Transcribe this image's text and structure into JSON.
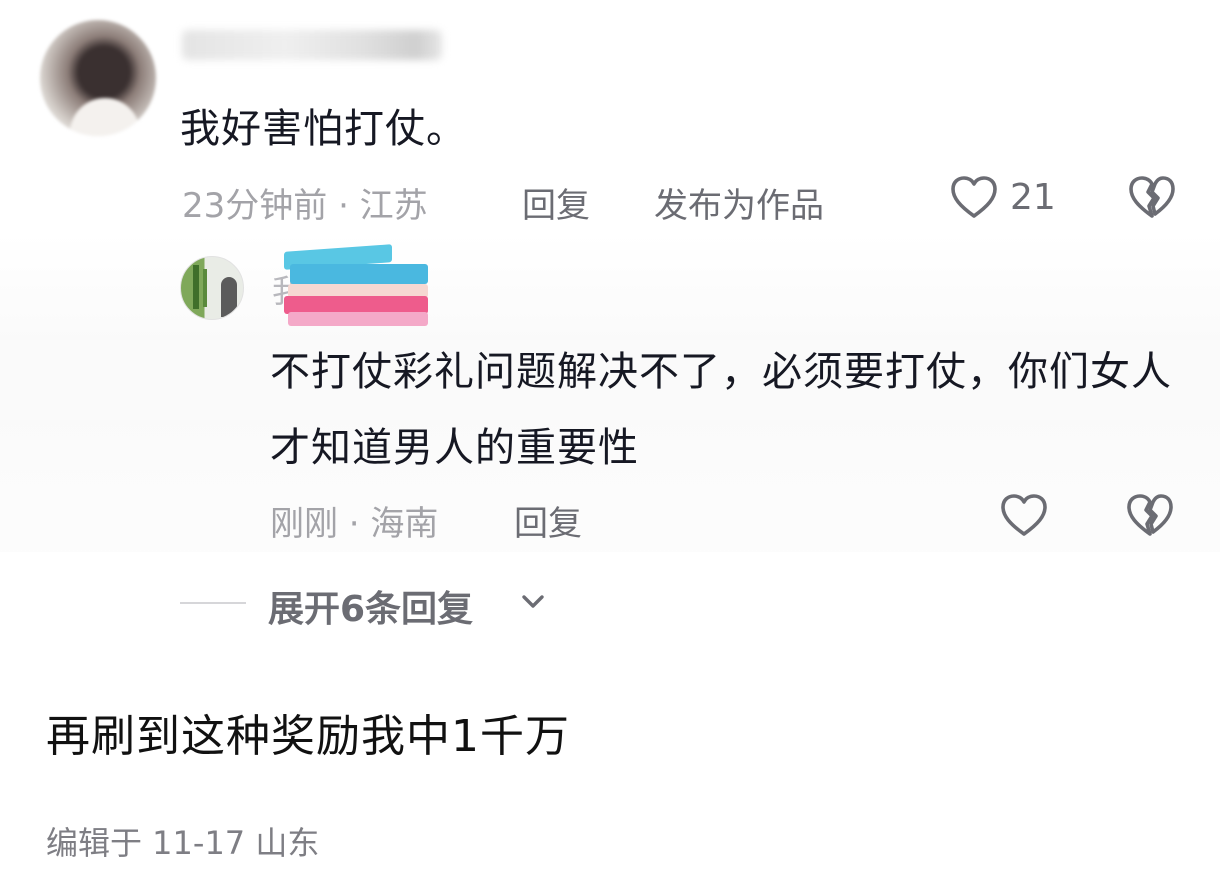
{
  "main_comment": {
    "text": "我好害怕打仗。",
    "time_location": "23分钟前 · 江苏",
    "reply_label": "回复",
    "publish_label": "发布为作品",
    "like_count": "21"
  },
  "reply": {
    "name_initial": "我",
    "text": "不打仗彩礼问题解决不了，必须要打仗，你们女人才知道男人的重要性",
    "time_location": "刚刚 · 海南",
    "reply_label": "回复"
  },
  "expand": {
    "label": "展开6条回复"
  },
  "caption": {
    "text": "再刷到这种奖励我中1千万",
    "edit_info": "编辑于 11-17 山东"
  },
  "icons": {
    "like": "heart-outline-icon",
    "dislike": "broken-heart-icon",
    "expand": "chevron-down-icon"
  },
  "colors": {
    "text_primary": "#161823",
    "text_meta": "#a3a3a8",
    "text_action": "#6b6c73"
  }
}
